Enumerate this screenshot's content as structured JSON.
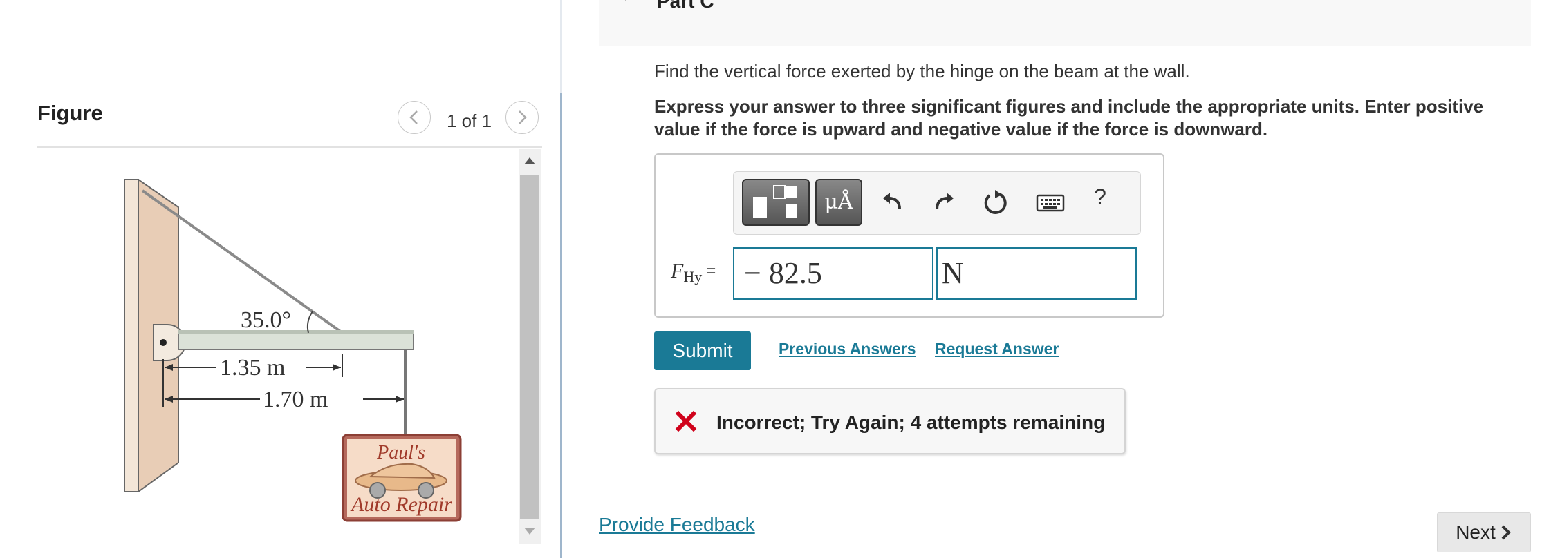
{
  "figure_panel": {
    "title": "Figure",
    "pager": "1 of 1",
    "angle_label": "35.0°",
    "dim_short": "1.35 m",
    "dim_long": "1.70 m",
    "sign_line1": "Paul's",
    "sign_line2": "Auto Repair"
  },
  "part": {
    "title": "Part C"
  },
  "question": {
    "prompt": "Find the vertical force exerted by the hinge on the beam at the wall.",
    "instructions": "Express your answer to three significant figures and include the appropriate units. Enter positive value if the force is upward and negative value if the force is downward."
  },
  "answer": {
    "variable_main": "F",
    "variable_sub": "Hy",
    "equals": "=",
    "value": "− 82.5",
    "unit": "N"
  },
  "toolbar": {
    "units_label": "μÅ",
    "help_label": "?"
  },
  "actions": {
    "submit": "Submit",
    "previous_answers": "Previous Answers",
    "request_answer": "Request Answer"
  },
  "feedback": {
    "message": "Incorrect; Try Again; 4 attempts remaining"
  },
  "footer": {
    "provide_feedback": "Provide Feedback",
    "next": "Next"
  },
  "colors": {
    "accent": "#1a7a96",
    "error": "#d0021b"
  }
}
